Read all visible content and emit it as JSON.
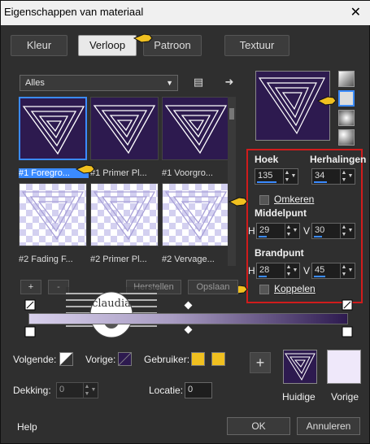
{
  "window": {
    "title": "Eigenschappen van materiaal"
  },
  "tabs": [
    {
      "label": "Kleur"
    },
    {
      "label": "Verloop"
    },
    {
      "label": "Patroon"
    },
    {
      "label": "Textuur"
    }
  ],
  "gallery": {
    "category": "Alles",
    "items": [
      {
        "label": "#1 Foregro..."
      },
      {
        "label": "#1 Primer Pl..."
      },
      {
        "label": "#1 Voorgro..."
      },
      {
        "label": "#2 Fading F..."
      },
      {
        "label": "#2 Primer Pl..."
      },
      {
        "label": "#2 Vervage..."
      }
    ]
  },
  "settings": {
    "angle_label": "Hoek",
    "angle_value": "135",
    "repeats_label": "Herhalingen",
    "repeats_value": "34",
    "invert_label": "Omkeren",
    "center_label": "Middelpunt",
    "center_h_label": "H",
    "center_h": "29",
    "center_v_label": "V",
    "center_v": "30",
    "focal_label": "Brandpunt",
    "focal_h_label": "H",
    "focal_h": "28",
    "focal_v_label": "V",
    "focal_v": "45",
    "link_label": "Koppelen"
  },
  "editor": {
    "add_label": "+",
    "remove_label": "-",
    "reset_label": "Herstellen",
    "save_label": "Opslaan"
  },
  "bottom": {
    "next_label": "Volgende:",
    "prev_label": "Vorige:",
    "user_label": "Gebruiker:",
    "opacity_label": "Dekking:",
    "opacity_value": "0",
    "location_label": "Locatie:",
    "location_value": "0",
    "current_label": "Huidige",
    "previous_label": "Vorige",
    "add_icon_label": "+"
  },
  "watermark": {
    "text": "claudia"
  },
  "footer": {
    "help": "Help",
    "ok": "OK",
    "cancel": "Annuleren"
  },
  "colors": {
    "accent": "#3b8bff",
    "purple": "#2d1a4f",
    "highlight": "#d01c1c",
    "yellow": "#f0c020"
  }
}
